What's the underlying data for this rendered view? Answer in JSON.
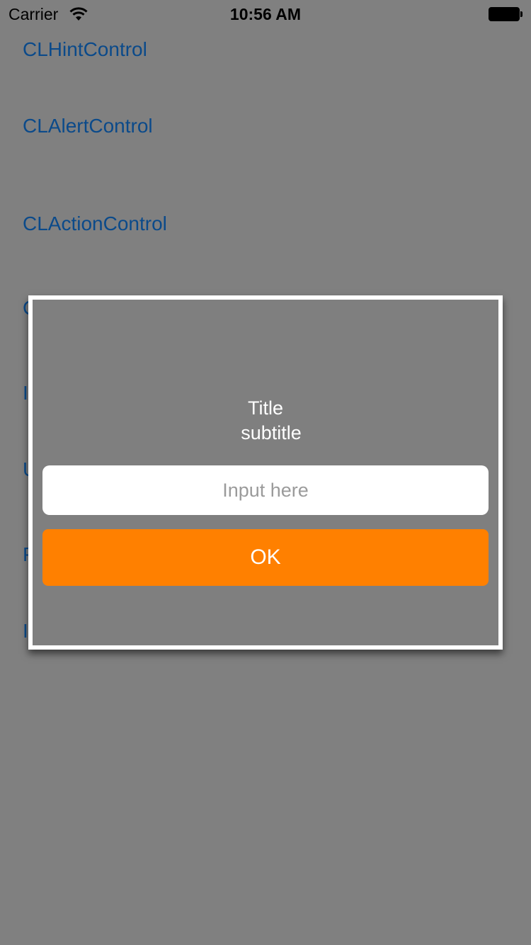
{
  "status_bar": {
    "carrier": "Carrier",
    "time": "10:56 AM",
    "wifi_icon": "wifi-icon",
    "battery_icon": "battery-icon"
  },
  "menu": {
    "items": [
      {
        "label": "CLHintControl"
      },
      {
        "label": "CLAlertControl"
      },
      {
        "label": "CLActionControl"
      },
      {
        "label": "C"
      },
      {
        "label": "I"
      },
      {
        "label": "U"
      },
      {
        "label": "P"
      },
      {
        "label": "I"
      }
    ]
  },
  "alert": {
    "title": "Title",
    "subtitle": "subtitle",
    "input_value": "",
    "input_placeholder": "Input here",
    "ok_label": "OK"
  },
  "colors": {
    "background": "#808080",
    "menu_text": "#0b4a8a",
    "alert_border": "#ffffff",
    "ok_button": "#ff8000"
  }
}
